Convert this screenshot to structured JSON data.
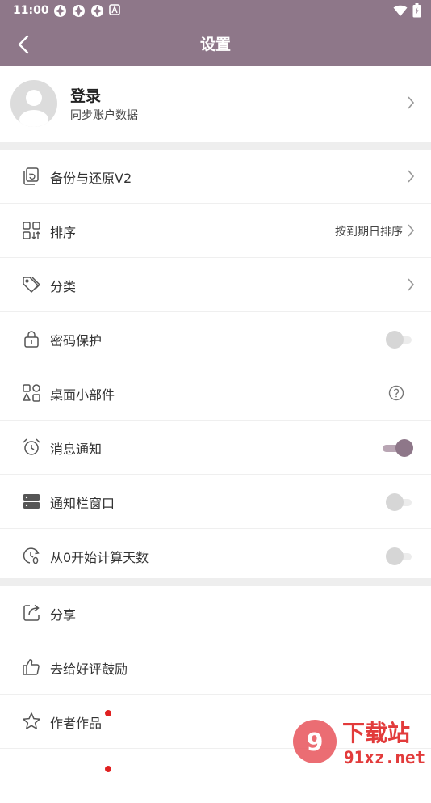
{
  "status_bar": {
    "time": "11:00",
    "notification_icons": [
      "app-notification-icon",
      "app-notification-icon",
      "app-notification-icon",
      "a-badge-icon"
    ],
    "right_icons": [
      "wifi-icon",
      "battery-icon"
    ]
  },
  "header": {
    "title": "设置",
    "background": "#8e7789"
  },
  "profile": {
    "name": "登录",
    "subtitle": "同步账户数据"
  },
  "sections": [
    {
      "items": [
        {
          "icon": "backup-restore-icon",
          "label": "备份与还原V2",
          "control": "chevron"
        },
        {
          "icon": "sort-icon",
          "label": "排序",
          "value": "按到期日排序",
          "control": "chevron"
        },
        {
          "icon": "tag-icon",
          "label": "分类",
          "control": "chevron"
        },
        {
          "icon": "lock-icon",
          "label": "密码保护",
          "control": "switch",
          "on": false
        },
        {
          "icon": "widget-icon",
          "label": "桌面小部件",
          "control": "help"
        },
        {
          "icon": "alarm-clock-icon",
          "label": "消息通知",
          "control": "switch",
          "on": true
        },
        {
          "icon": "notification-bar-icon",
          "label": "通知栏窗口",
          "control": "switch",
          "on": false
        },
        {
          "icon": "count-from-zero-icon",
          "label": "从0开始计算天数",
          "control": "switch",
          "on": false
        }
      ]
    },
    {
      "items": [
        {
          "icon": "share-icon",
          "label": "分享"
        },
        {
          "icon": "thumbs-up-icon",
          "label": "去给好评鼓励"
        },
        {
          "icon": "star-icon",
          "label": "作者作品",
          "badge": true
        }
      ]
    }
  ],
  "watermark": {
    "line1": "下载站",
    "line2": "91xz.net"
  },
  "colors": {
    "accent": "#8e7789",
    "badge": "#e02020"
  }
}
